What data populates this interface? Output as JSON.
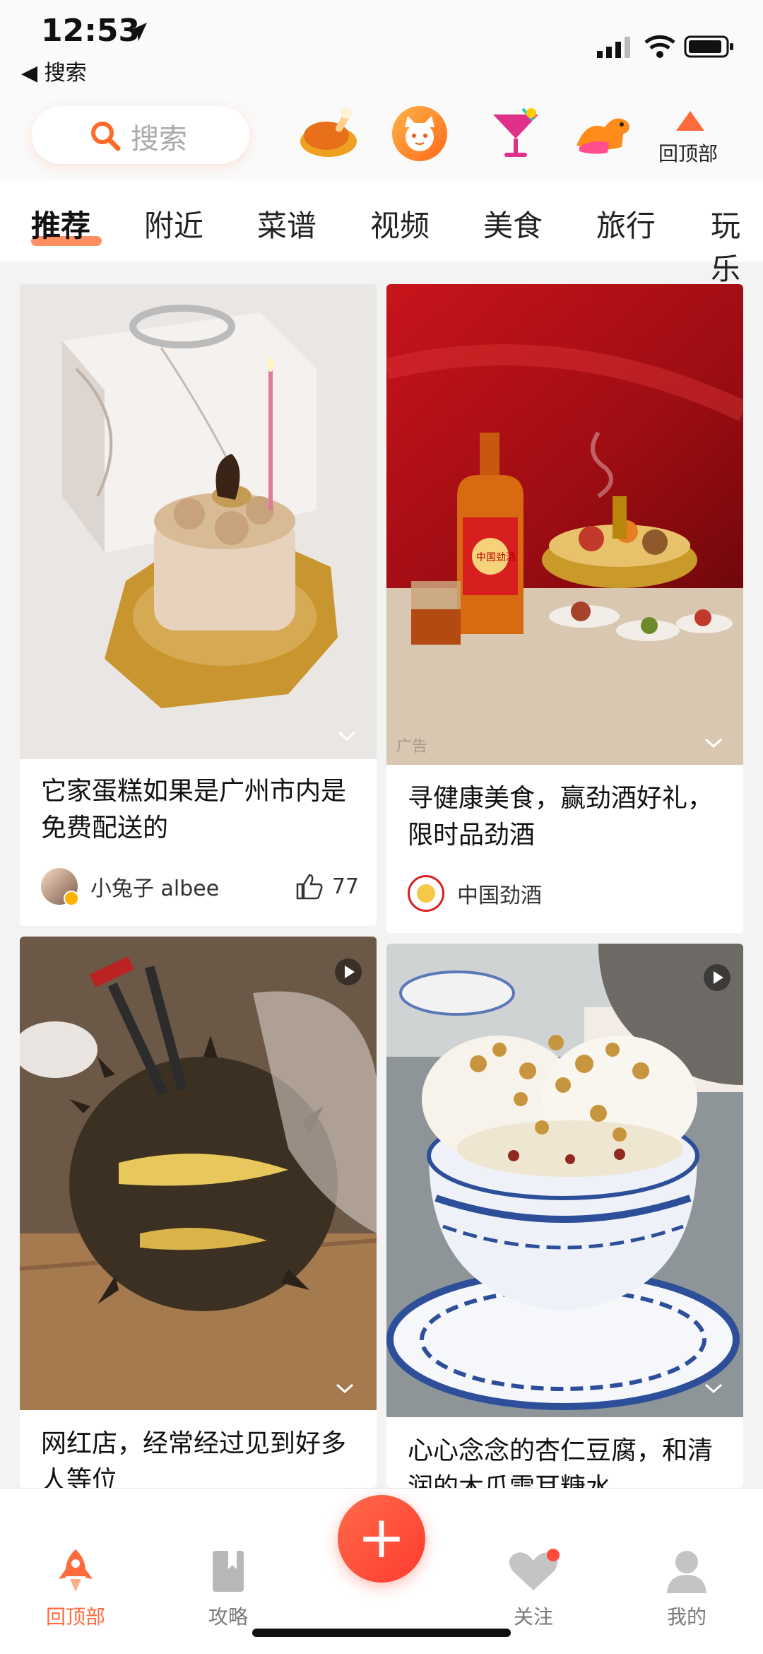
{
  "status_bar": {
    "time": "12:53",
    "back_label": "◀ 搜索"
  },
  "topbar": {
    "search_placeholder": "搜索",
    "back_to_top_label": "回顶部",
    "shortcut_icons": [
      "roast-chicken-icon",
      "cat-mascot-icon",
      "cocktail-icon",
      "camel-icon"
    ]
  },
  "tabs": [
    "推荐",
    "附近",
    "菜谱",
    "视频",
    "美食",
    "旅行",
    "玩乐"
  ],
  "feed": [
    {
      "caption": "它家蛋糕如果是广州市内是免费配送的",
      "author": "小兔子 albee",
      "likes": "77"
    },
    {
      "caption": "寻健康美食，赢劲酒好礼，限时品劲酒",
      "author": "中国劲酒",
      "ad_label": "广告",
      "bottle_label": "中国劲酒"
    },
    {
      "caption": "网红店，经常经过见到好多人等位"
    },
    {
      "caption": "心心念念的杏仁豆腐，和清润的木瓜雪耳糖水"
    }
  ],
  "bottom_nav": [
    {
      "label": "回顶部"
    },
    {
      "label": "攻略"
    },
    {
      "label": "+"
    },
    {
      "label": "关注"
    },
    {
      "label": "我的"
    }
  ],
  "colors": {
    "accent": "#ff6a3d",
    "fab": "#ff3b2f"
  }
}
